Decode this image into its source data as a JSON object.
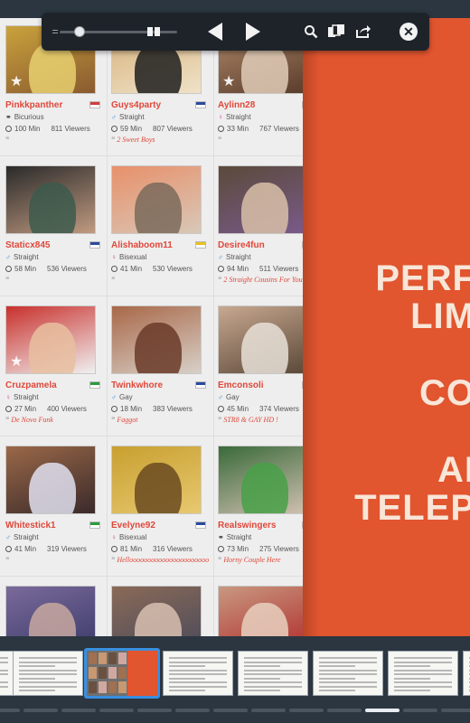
{
  "toolbar": {
    "progress_fraction": 0.08,
    "icons": [
      "slider-knob",
      "double-page-icon",
      "previous-arrow-icon",
      "next-arrow-icon",
      "search-icon",
      "thumbnails-icon",
      "share-icon",
      "close-icon"
    ]
  },
  "cover": {
    "lines": [
      "PERF",
      "LIM",
      "CO",
      "AI",
      "TELEP"
    ],
    "background": "#e1552f",
    "text_color": "#f8e6d8"
  },
  "profiles": [
    {
      "name": "Pinkkpanther",
      "orientation": "Bicurious",
      "sym": "couple",
      "minutes": "100 Min",
      "viewers": "811 Viewers",
      "quote": "",
      "star": true,
      "thumb": [
        "#c9a23c",
        "#e8d070",
        "#8a5a30"
      ],
      "flag": "#d23b3b"
    },
    {
      "name": "Guys4party",
      "orientation": "Straight",
      "sym": "male",
      "minutes": "59 Min",
      "viewers": "807 Viewers",
      "quote": "2 Sweet Boys",
      "star": false,
      "thumb": [
        "#d6b07a",
        "#1f1f1f",
        "#f0e2c8"
      ],
      "flag": "#2c4a9c"
    },
    {
      "name": "Aylinn28",
      "orientation": "Straight",
      "sym": "female",
      "minutes": "33 Min",
      "viewers": "767 Viewers",
      "quote": "",
      "star": true,
      "thumb": [
        "#b08a6a",
        "#e0cdb8",
        "#5a3c2c"
      ],
      "flag": "#d23b3b"
    },
    {
      "name": "Staticx845",
      "orientation": "Straight",
      "sym": "male",
      "minutes": "58 Min",
      "viewers": "536 Viewers",
      "quote": "",
      "star": false,
      "thumb": [
        "#2a2a2a",
        "#3c5a4c",
        "#c09a80"
      ],
      "flag": "#2c4a9c"
    },
    {
      "name": "Alishaboom11",
      "orientation": "Bisexual",
      "sym": "female",
      "minutes": "41 Min",
      "viewers": "530 Viewers",
      "quote": "",
      "star": false,
      "thumb": [
        "#e8906a",
        "#7a6a5a",
        "#d8c8b8"
      ],
      "flag": "#e8c020"
    },
    {
      "name": "Desire4fun",
      "orientation": "Straight",
      "sym": "male",
      "minutes": "94 Min",
      "viewers": "511 Viewers",
      "quote": "2 Straight Cousins For You",
      "star": false,
      "thumb": [
        "#5a4a3a",
        "#d8c0a8",
        "#7a5a8a"
      ],
      "flag": "#2c4a9c"
    },
    {
      "name": "Cruzpamela",
      "orientation": "Straight",
      "sym": "female",
      "minutes": "27 Min",
      "viewers": "400 Viewers",
      "quote": "De Novo Funk",
      "star": true,
      "thumb": [
        "#c8302c",
        "#e8c0a0",
        "#f0f0f0"
      ],
      "flag": "#2a9c3a"
    },
    {
      "name": "Twinkwhore",
      "orientation": "Gay",
      "sym": "male",
      "minutes": "18 Min",
      "viewers": "383 Viewers",
      "quote": "Faggot",
      "star": false,
      "thumb": [
        "#a86848",
        "#6a3a28",
        "#d8d0c8"
      ],
      "flag": "#2c4a9c"
    },
    {
      "name": "Emconsoli",
      "orientation": "Gay",
      "sym": "male",
      "minutes": "45 Min",
      "viewers": "374 Viewers",
      "quote": "STR8 & GAY HD !",
      "star": false,
      "thumb": [
        "#c8a890",
        "#e8e0d8",
        "#5a4838"
      ],
      "flag": "#2c4a9c"
    },
    {
      "name": "Whitestick1",
      "orientation": "Straight",
      "sym": "male",
      "minutes": "41 Min",
      "viewers": "319 Viewers",
      "quote": "",
      "star": false,
      "thumb": [
        "#9a6848",
        "#e0e0f0",
        "#3a2a2a"
      ],
      "flag": "#2a9c3a"
    },
    {
      "name": "Evelyne92",
      "orientation": "Bisexual",
      "sym": "female",
      "minutes": "81 Min",
      "viewers": "316 Viewers",
      "quote": "Helloooooooooooooooooooooo",
      "star": false,
      "thumb": [
        "#c8a030",
        "#6a4a20",
        "#e8c870"
      ],
      "flag": "#2c4a9c"
    },
    {
      "name": "Realswingers",
      "orientation": "Straight",
      "sym": "couple",
      "minutes": "73 Min",
      "viewers": "275 Viewers",
      "quote": "Horny Couple Here",
      "star": false,
      "thumb": [
        "#3a6a3a",
        "#48a048",
        "#d0c0b0"
      ],
      "flag": "#2c4a9c"
    },
    {
      "name": "",
      "orientation": "",
      "sym": "",
      "minutes": "",
      "viewers": "",
      "quote": "",
      "star": false,
      "thumb": [
        "#7a6a9a",
        "#c8a8a0",
        "#3a3a6a"
      ],
      "flag": ""
    },
    {
      "name": "",
      "orientation": "",
      "sym": "",
      "minutes": "",
      "viewers": "",
      "quote": "",
      "star": false,
      "thumb": [
        "#8a6a58",
        "#d8c0b0",
        "#4a4a5a"
      ],
      "flag": ""
    },
    {
      "name": "",
      "orientation": "",
      "sym": "",
      "minutes": "",
      "viewers": "",
      "quote": "",
      "star": false,
      "thumb": [
        "#c89880",
        "#e8d0c0",
        "#b02a2a"
      ],
      "flag": ""
    }
  ],
  "strip": {
    "active_index": 2,
    "page_indicator_active": 10
  }
}
